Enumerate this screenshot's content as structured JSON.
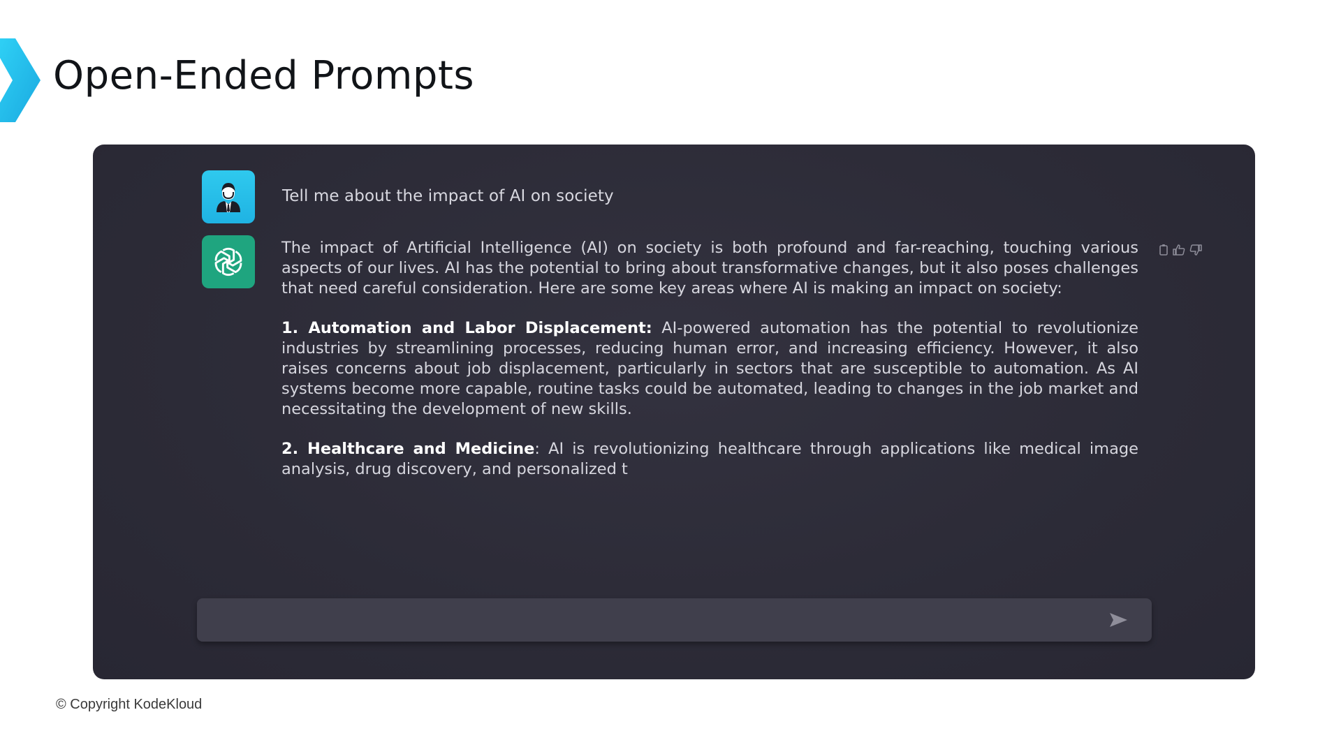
{
  "slide": {
    "title": "Open-Ended Prompts",
    "copyright": "© Copyright KodeKloud",
    "accent_color": "#1fb8e8"
  },
  "chat": {
    "user_icon": "user-avatar-icon",
    "bot_icon": "openai-logo-icon",
    "user_message": "Tell me about the impact of AI on society",
    "bot_response": {
      "intro": "The impact of Artificial Intelligence (AI) on society is both profound and far-reaching, touching various aspects of our lives. AI has the potential to bring about transformative changes, but it also poses challenges that need careful consideration. Here are some key areas where AI is making an impact on society:",
      "points": [
        {
          "heading": "1. Automation and Labor Displacement:",
          "text": " AI-powered automation has the potential to revolutionize industries by streamlining processes, reducing human error, and increasing efficiency. However, it also raises concerns about job displacement, particularly in sectors that are susceptible to automation. As AI systems become more capable, routine tasks could be automated, leading to changes in the job market and necessitating the development of new skills."
        },
        {
          "heading": "2. Healthcare and Medicine",
          "text": ": AI is revolutionizing healthcare through applications like medical image analysis, drug discovery, and personalized t"
        }
      ]
    },
    "actions": [
      "copy-icon",
      "thumbs-up-icon",
      "thumbs-down-icon"
    ],
    "composer": {
      "placeholder": "",
      "send_icon": "send-icon"
    },
    "colors": {
      "panel_bg": "#2d2c38",
      "user_avatar_bg": "#1fb3e3",
      "bot_avatar_bg": "#1fa57f"
    }
  }
}
